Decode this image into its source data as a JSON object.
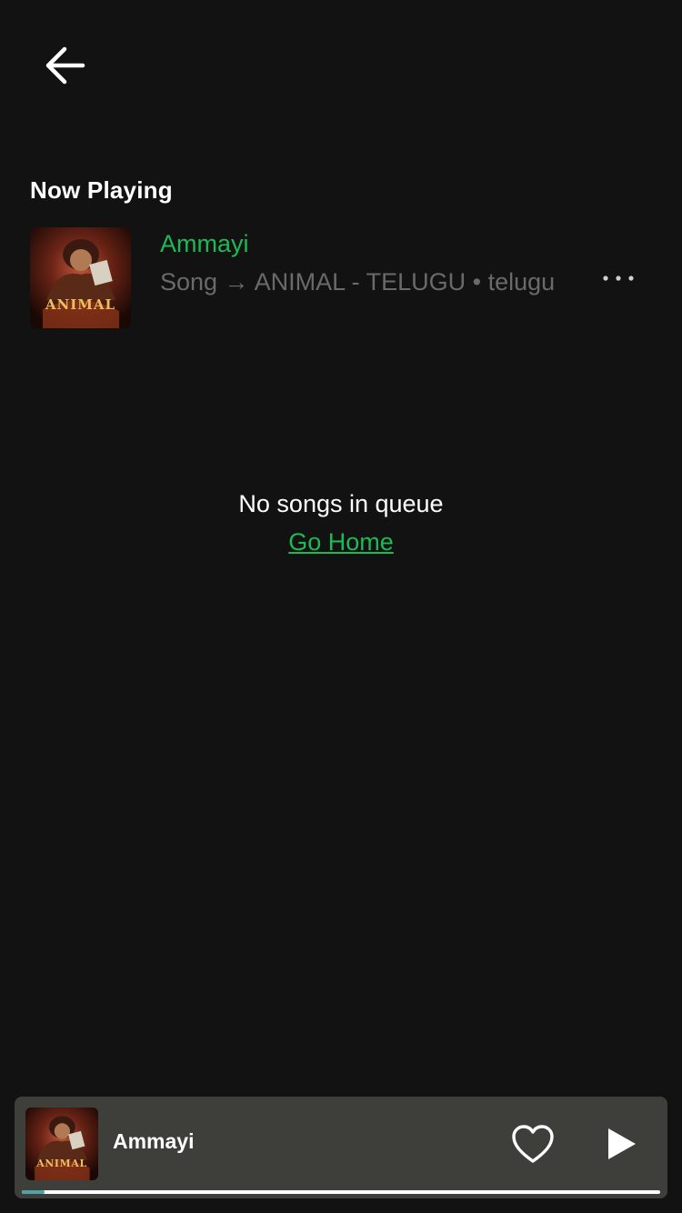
{
  "header": {
    "back_icon": "arrow-left-icon"
  },
  "now_playing": {
    "section_title": "Now Playing",
    "track": {
      "title": "Ammayi",
      "meta": "Song → ANIMAL - TELUGU • telugu",
      "cover_text": "ANIMAL"
    },
    "more_icon": "more-horizontal-icon"
  },
  "queue": {
    "empty_message": "No songs in queue",
    "go_home_label": "Go Home"
  },
  "player": {
    "title": "Ammayi",
    "cover_text": "ANIMAL",
    "progress": 0.035,
    "heart_icon": "heart-outline-icon",
    "play_icon": "play-icon"
  },
  "colors": {
    "background": "#121212",
    "accent": "#1db954",
    "player_bg": "#3e3f3b",
    "progress_fill": "#4fa3a6"
  }
}
